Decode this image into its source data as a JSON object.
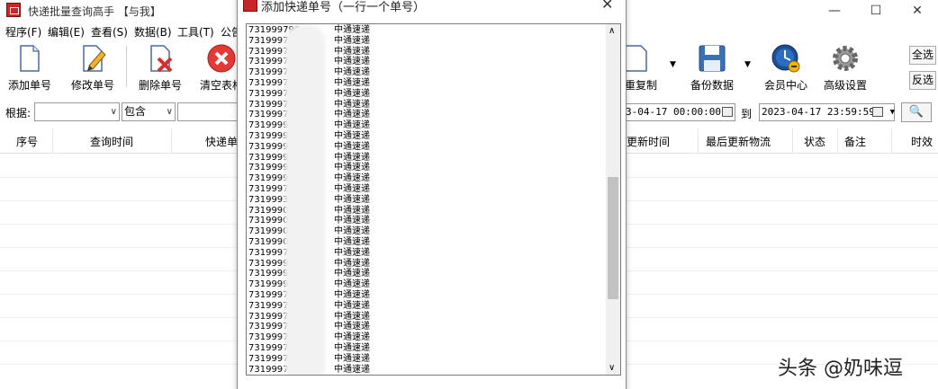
{
  "window": {
    "title": "快递批量查询高手 【与我】",
    "minimize": "—",
    "maximize": "☐",
    "close": "✕"
  },
  "menu": [
    "程序(F)",
    "编辑(E)",
    "查看(S)",
    "数据(B)",
    "工具(T)",
    "公告"
  ],
  "toolbar": {
    "add": "添加单号",
    "edit": "修改单号",
    "delete": "删除单号",
    "clear": "清空表格",
    "copy": "重复制",
    "backup": "备份数据",
    "member": "会员中心",
    "advanced": "高级设置",
    "select_all": "全选",
    "invert": "反选"
  },
  "search": {
    "label": "根据:",
    "field_value": "",
    "match_value": "包含",
    "date_from": "3-04-17 00:00:00",
    "to": "到",
    "date_to": "2023-04-17 23:59:59"
  },
  "columns": [
    "序号",
    "查询时间",
    "快递单",
    "更新时间",
    "最后更新物流",
    "状态",
    "备注",
    "时效"
  ],
  "dialog": {
    "title": "添加快递单号（一行一个单号）",
    "close": "✕",
    "lines": [
      {
        "num": "731999790",
        "courier": "中通速递"
      },
      {
        "num": "731999797",
        "courier": "中通速递"
      },
      {
        "num": "731999712",
        "courier": "中通速递"
      },
      {
        "num": "731999708",
        "courier": "中通速递"
      },
      {
        "num": "731999710",
        "courier": "中通速递"
      },
      {
        "num": "731999717",
        "courier": "中通速递"
      },
      {
        "num": "731999703",
        "courier": "中通速递"
      },
      {
        "num": "731999713",
        "courier": "中通速递"
      },
      {
        "num": "731999709",
        "courier": "中通速递"
      },
      {
        "num": "7319999772",
        "courier": "中通速递"
      },
      {
        "num": "7319999714",
        "courier": "中通速递"
      },
      {
        "num": "7319999692",
        "courier": "中通速递"
      },
      {
        "num": "7319999836",
        "courier": "中通速递"
      },
      {
        "num": "7319999826",
        "courier": "中通速递"
      },
      {
        "num": "7319999824",
        "courier": "中通速递"
      },
      {
        "num": "7319997122",
        "courier": "中通速递"
      },
      {
        "num": "7319993037",
        "courier": "中通速递"
      },
      {
        "num": "73199902480",
        "courier": "中通速递"
      },
      {
        "num": "73199904729",
        "courier": "中通速递"
      },
      {
        "num": "73199908069",
        "courier": "中通速递"
      },
      {
        "num": "73199902213",
        "courier": "中通速递"
      },
      {
        "num": "7319997404",
        "courier": "中通速递"
      },
      {
        "num": "7319999554",
        "courier": "中通速递"
      },
      {
        "num": "7319999463",
        "courier": "中通速递"
      },
      {
        "num": "7319999792",
        "courier": "中通速递"
      },
      {
        "num": "731999725",
        "courier": "中通速递"
      },
      {
        "num": "731999727",
        "courier": "中通速递"
      },
      {
        "num": "731999710",
        "courier": "中通速递"
      },
      {
        "num": "731999716",
        "courier": "中通速递"
      },
      {
        "num": "731999709",
        "courier": "中通速递"
      },
      {
        "num": "731999710",
        "courier": "中通速递"
      },
      {
        "num": "731999709",
        "courier": "中通速递"
      },
      {
        "num": "731999710",
        "courier": "中通速递"
      }
    ]
  },
  "watermark": "头条 @奶味逗",
  "colors": {
    "icon_red": "#c62828",
    "clear_red": "#e53935",
    "member_blue": "#1e4f8f",
    "scroll_thumb": "#c2c2c2"
  }
}
